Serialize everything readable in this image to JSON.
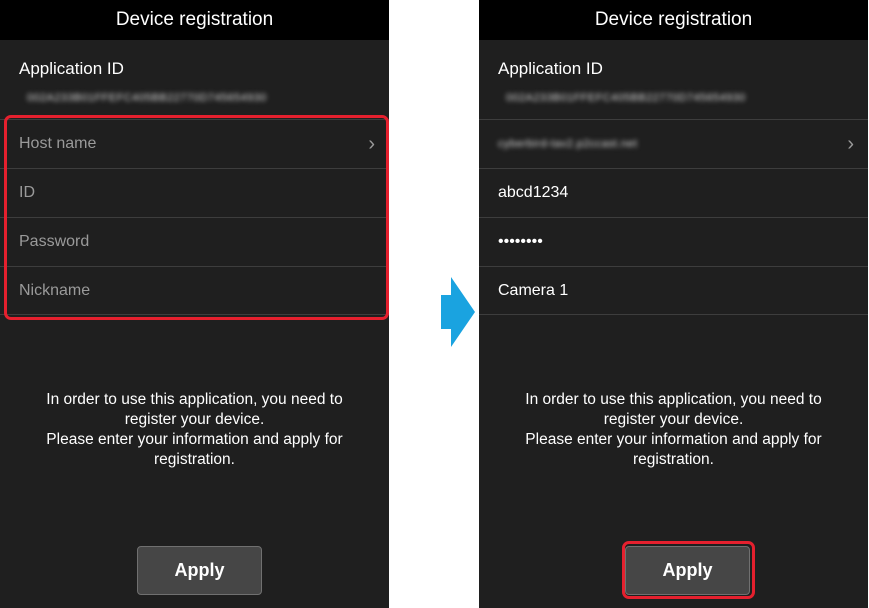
{
  "left_screen": {
    "title": "Device registration",
    "application_id_label": "Application ID",
    "application_id_value": "002A233B01FFEFC405BB22770D745654930",
    "fields": [
      {
        "text": "Host name",
        "has_chevron": true
      },
      {
        "text": "ID",
        "has_chevron": false
      },
      {
        "text": "Password",
        "has_chevron": false
      },
      {
        "text": "Nickname",
        "has_chevron": false
      }
    ],
    "info_lines": [
      "In order to use this application, you need to register your device.",
      "Please enter your information and apply for registration."
    ],
    "apply_label": "Apply"
  },
  "right_screen": {
    "title": "Device registration",
    "application_id_label": "Application ID",
    "application_id_value": "002A233B01FFEFC405BB22770D745654930",
    "fields": [
      {
        "text": "cyberbird-tav2.p2ccast.net",
        "has_chevron": true
      },
      {
        "text": "abcd1234",
        "has_chevron": false
      },
      {
        "text": "••••••••",
        "has_chevron": false
      },
      {
        "text": "Camera 1",
        "has_chevron": false
      }
    ],
    "info_lines": [
      "In order to use this application, you need to register your device.",
      "Please enter your information and apply for registration."
    ],
    "apply_label": "Apply"
  },
  "icons": {
    "chevron": "chevron-right-icon",
    "transition": "arrow-right-icon"
  },
  "colors": {
    "screen_background": "#1f1f1f",
    "title_bar": "#000000",
    "placeholder_text": "#9a9a9a",
    "button_background": "#464646",
    "highlight": "#e5202e",
    "transition_arrow": "#1aa3e0"
  }
}
